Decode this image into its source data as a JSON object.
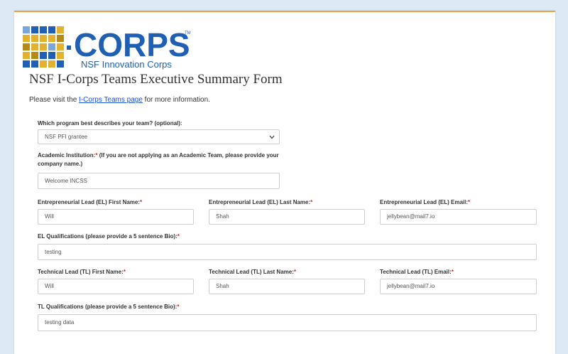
{
  "logo": {
    "wordmark": "CORPS",
    "trademark": "TM",
    "subtitle": "NSF Innovation Corps",
    "colors": {
      "blue": "#1f5fb4",
      "gold": "#e2b12e",
      "dark_gold": "#b58a18",
      "light_blue": "#7aa6d8"
    }
  },
  "form": {
    "title": "NSF I-Corps Teams Executive Summary Form",
    "intro_prefix": "Please visit the ",
    "intro_link": "I-Corps Teams page",
    "intro_suffix": " for more information."
  },
  "fields": {
    "program": {
      "label": "Which program best describes your team? (optional):",
      "value": "NSF PFI grantee"
    },
    "institution": {
      "label_main": "Academic Institution:",
      "label_req": "*",
      "label_extra": " (If you are not applying as an Academic Team, please provide your company name.)",
      "value": "Welcome INCSS"
    },
    "el_first": {
      "label": "Entrepreneurial Lead (EL) First Name:",
      "req": "*",
      "value": "Will"
    },
    "el_last": {
      "label": "Entrepreneurial Lead (EL) Last Name:",
      "req": "*",
      "value": "Shah"
    },
    "el_email": {
      "label": "Entrepreneurial Lead (EL) Email:",
      "req": "*",
      "value": "jellybean@mail7.io"
    },
    "el_bio": {
      "label": "EL Qualifications (please provide a 5 sentence Bio):",
      "req": "*",
      "value": "testing"
    },
    "tl_first": {
      "label": "Technical Lead (TL) First Name:",
      "req": "*",
      "value": "Will"
    },
    "tl_last": {
      "label": "Technical Lead (TL) Last Name:",
      "req": "*",
      "value": "Shah"
    },
    "tl_email": {
      "label": "Technical Lead (TL) Email:",
      "req": "*",
      "value": "jellybean@mail7.io"
    },
    "tl_bio": {
      "label": "TL Qualifications (please provide a 5 sentence Bio):",
      "req": "*",
      "value": "testing data"
    }
  },
  "icons": {
    "dropdown": "chevron-down-icon"
  }
}
